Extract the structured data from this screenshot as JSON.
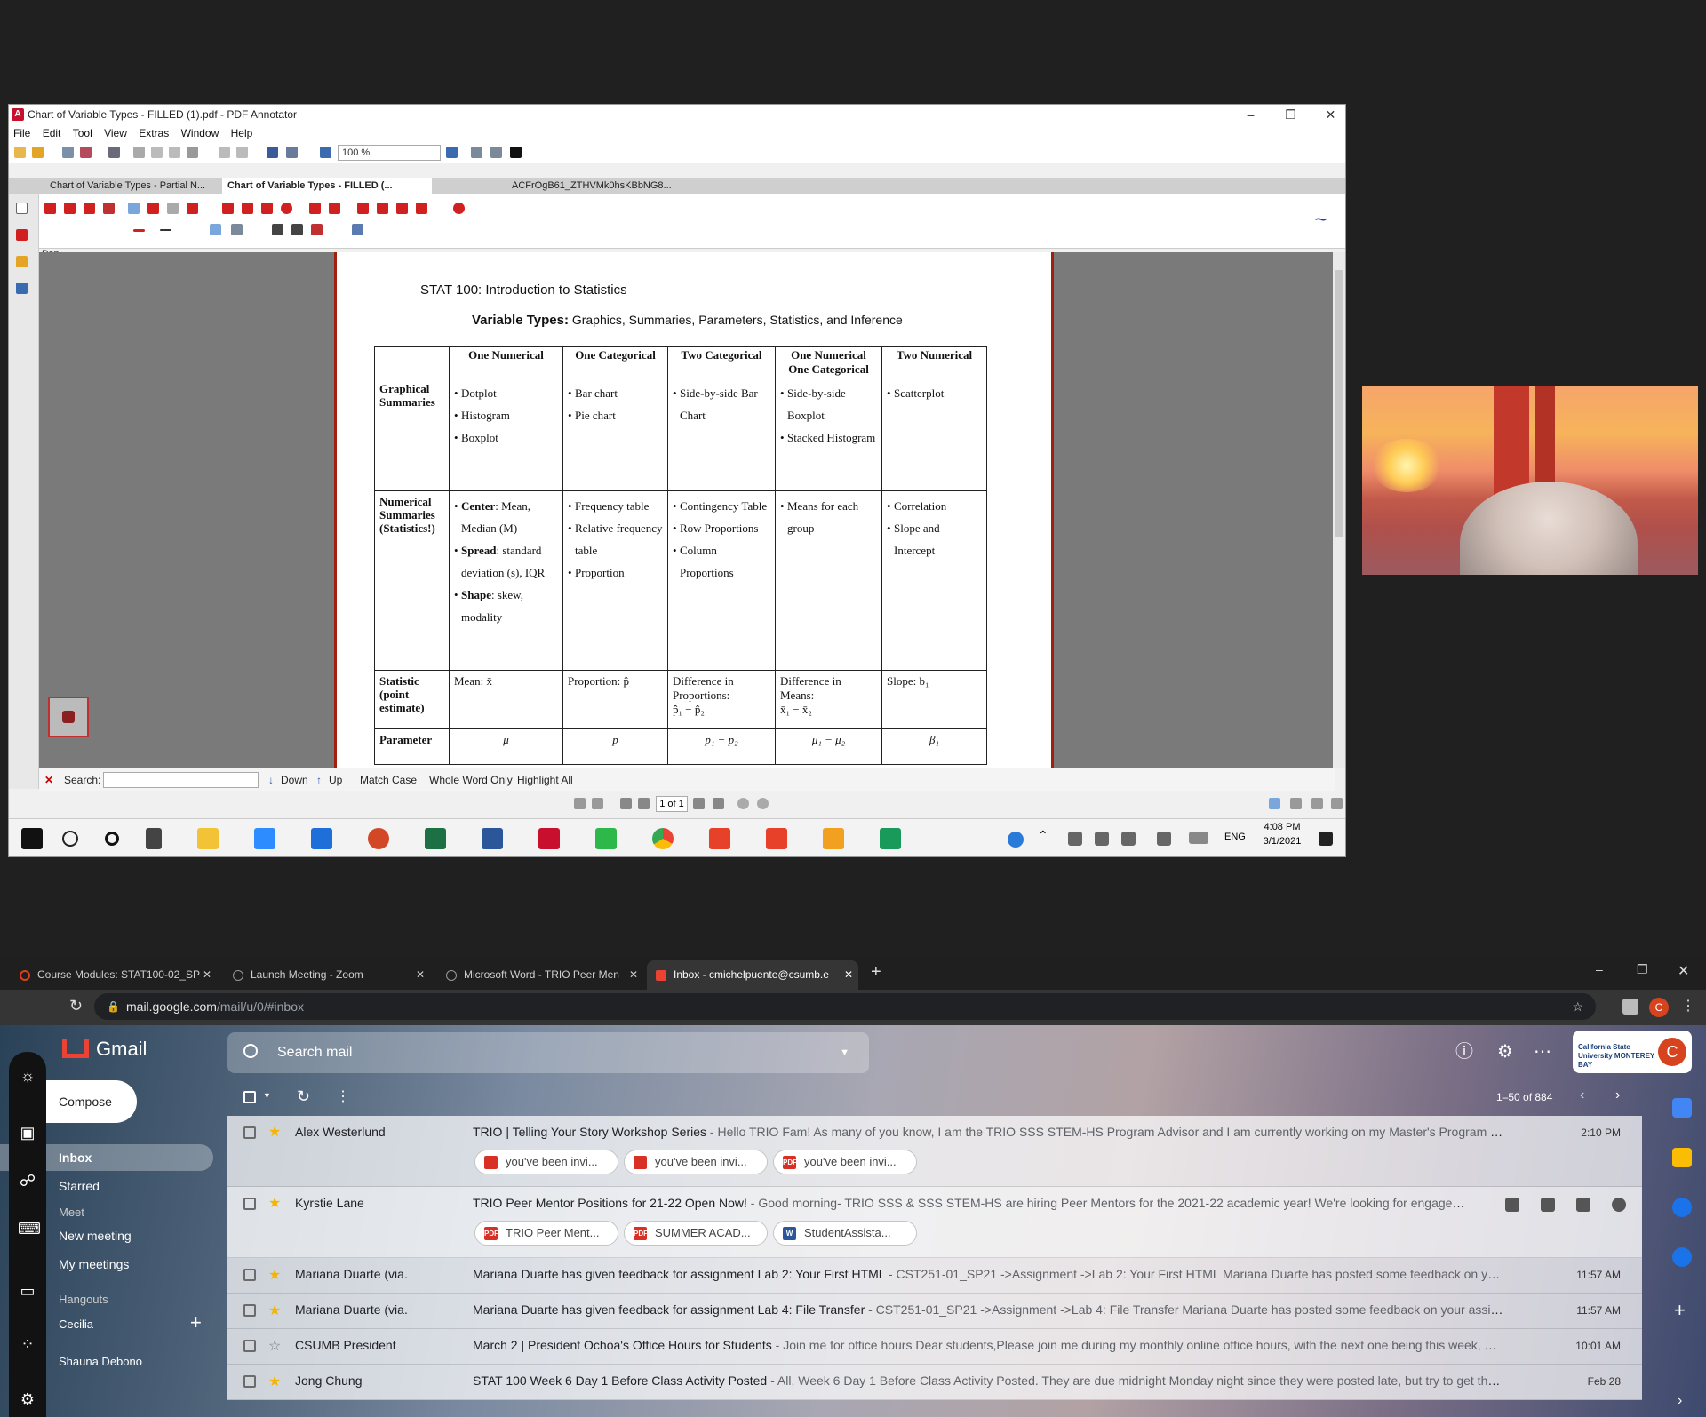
{
  "pdf_window": {
    "title": "Chart of Variable Types - FILLED (1).pdf - PDF Annotator",
    "menu": [
      "File",
      "Edit",
      "Tool",
      "View",
      "Extras",
      "Window",
      "Help"
    ],
    "zoom": "100 %",
    "tabs": [
      "Chart of Variable Types - Partial N...",
      "Chart of Variable Types - FILLED (...",
      "ACFrOgB61_ZTHVMk0hsKBbNG8..."
    ],
    "tool_label": "Pen",
    "search": {
      "label": "Search:",
      "value": "",
      "down": "Down",
      "up": "Up",
      "match_case": "Match Case",
      "whole_word": "Whole Word Only",
      "highlight_all": "Highlight All"
    },
    "page_indicator": "1 of 1",
    "document": {
      "course": "STAT 100: Introduction to Statistics",
      "subtitle_bold": "Variable Types:",
      "subtitle_rest": " Graphics, Summaries, Parameters, Statistics, and Inference",
      "columns": [
        "One Numerical",
        "One Categorical",
        "Two Categorical",
        "One Numerical One Categorical",
        "Two Numerical"
      ],
      "rows": {
        "graphical": {
          "header": "Graphical Summaries",
          "c1": [
            "Dotplot",
            "Histogram",
            "Boxplot"
          ],
          "c2": [
            "Bar chart",
            "Pie chart"
          ],
          "c3": [
            "Side-by-side Bar Chart"
          ],
          "c4": [
            "Side-by-side Boxplot",
            "Stacked Histogram"
          ],
          "c5": [
            "Scatterplot"
          ]
        },
        "numerical": {
          "header": "Numerical Summaries (Statistics!)",
          "c1": [
            {
              "b": "Center",
              "t": ": Mean, Median (M)"
            },
            {
              "b": "Spread",
              "t": ": standard deviation (s), IQR"
            },
            {
              "b": "Shape",
              "t": ": skew, modality"
            }
          ],
          "c2": [
            "Frequency table",
            "Relative frequency table",
            "Proportion"
          ],
          "c3": [
            "Contingency Table",
            "Row Proportions",
            "Column Proportions"
          ],
          "c4": [
            "Means for each group"
          ],
          "c5": [
            "Correlation",
            "Slope and Intercept"
          ]
        },
        "statistic": {
          "header": "Statistic (point estimate)",
          "c1": "Mean: x̄",
          "c2": "Proportion: p̂",
          "c3a": "Difference in Proportions:",
          "c3b": "p̂₁ − p̂₂",
          "c4a": "Difference in Means:",
          "c4b": "x̄₁ − x̄₂",
          "c5": "Slope: b₁"
        },
        "parameter": {
          "header": "Parameter",
          "c1": "μ",
          "c2": "p",
          "c3": "p₁ − p₂",
          "c4": "μ₁ − μ₂",
          "c5": "β₁"
        }
      }
    },
    "taskbar": {
      "language": "ENG",
      "time": "4:08 PM",
      "date": "3/1/2021"
    }
  },
  "chrome": {
    "tabs": [
      {
        "label": "Course Modules: STAT100-02_SP",
        "color": "#d8431f"
      },
      {
        "label": "Launch Meeting - Zoom",
        "color": "#888888"
      },
      {
        "label": "Microsoft Word - TRIO Peer Men",
        "color": "#888888"
      },
      {
        "label": "Inbox - cmichelpuente@csumb.e",
        "color": "#ea4335"
      }
    ],
    "url_host": "mail.google.com",
    "url_path": "/mail/u/0/#inbox",
    "profile_letter": "C"
  },
  "gmail": {
    "brand": "Gmail",
    "search_placeholder": "Search mail",
    "compose": "Compose",
    "nav": [
      "Inbox",
      "Starred"
    ],
    "meet_header": "Meet",
    "meet_items": [
      "New meeting",
      "My meetings"
    ],
    "hangouts_header": "Hangouts",
    "hangouts_user": "Cecilia",
    "hangouts_contact": "Shauna Debono",
    "badge_text": "California State University MONTEREY BAY",
    "avatar_letter": "C",
    "pagination": "1–50 of 884",
    "emails": [
      {
        "sender": "Alex Westerlund",
        "subject": "TRIO | Telling Your Story Workshop Series",
        "snippet": " - Hello TRIO Fam! As many of you know, I am the TRIO SSS STEM-HS Program Advisor and I am currently working on my Master's Program at San...",
        "time": "2:10 PM",
        "starred": true,
        "chips": [
          {
            "label": "you've been invi...",
            "type": "img"
          },
          {
            "label": "you've been invi...",
            "type": "img"
          },
          {
            "label": "you've been invi...",
            "type": "pdf"
          }
        ]
      },
      {
        "sender": "Kyrstie Lane",
        "subject": "TRIO Peer Mentor Positions for 21-22 Open Now!",
        "snippet": " - Good morning- TRIO SSS & SSS STEM-HS are hiring Peer Mentors for the 2021-22 academic year! We're looking for engaged, c...",
        "time": "",
        "starred": true,
        "chips": [
          {
            "label": "TRIO Peer Ment...",
            "type": "pdf"
          },
          {
            "label": "SUMMER ACAD...",
            "type": "pdf"
          },
          {
            "label": "StudentAssista...",
            "type": "word"
          }
        ]
      },
      {
        "sender": "Mariana Duarte (via.",
        "subject": "Mariana Duarte has given feedback for assignment Lab 2: Your First HTML",
        "snippet": " - CST251-01_SP21 ->Assignment ->Lab 2: Your First HTML Mariana Duarte has posted some feedback on your a...",
        "time": "11:57 AM",
        "starred": true
      },
      {
        "sender": "Mariana Duarte (via.",
        "subject": "Mariana Duarte has given feedback for assignment Lab 4: File Transfer",
        "snippet": " - CST251-01_SP21 ->Assignment ->Lab 4: File Transfer Mariana Duarte has posted some feedback on your assignm...",
        "time": "11:57 AM",
        "starred": true
      },
      {
        "sender": "CSUMB President",
        "subject": "March 2 | President Ochoa's Office Hours for Students",
        "snippet": " - Join me for office hours Dear students,Please join me during my monthly online office hours, with the next one being this week, Tue...",
        "time": "10:01 AM",
        "starred": false
      },
      {
        "sender": "Jong Chung",
        "subject": "STAT 100 Week 6 Day 1 Before Class Activity Posted",
        "snippet": " - All, Week 6 Day 1 Before Class Activity Posted. They are due midnight Monday night since they were posted late, but try to get them c...",
        "time": "Feb 28",
        "starred": true
      }
    ]
  },
  "colors": {
    "pdf_accent": "#c8102e",
    "gmail_red": "#ea4335",
    "star": "#f4b400"
  }
}
